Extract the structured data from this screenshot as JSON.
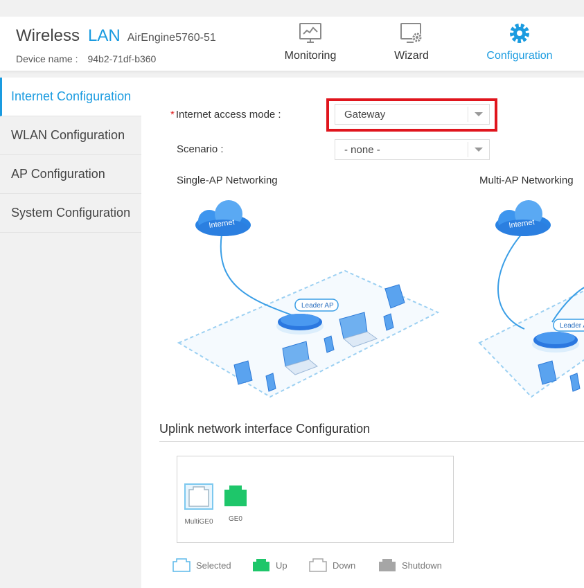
{
  "header": {
    "brand_wireless": "Wireless",
    "brand_lan": "LAN",
    "model": "AirEngine5760-51",
    "device_name_label": "Device name :",
    "device_name_value": "94b2-71df-b360",
    "nav": [
      {
        "label": "Monitoring",
        "icon": "monitor-chart-icon"
      },
      {
        "label": "Wizard",
        "icon": "monitor-gear-icon"
      },
      {
        "label": "Configuration",
        "icon": "gear-icon"
      }
    ],
    "active_nav": "Configuration"
  },
  "sidebar": {
    "items": [
      {
        "label": "Internet Configuration",
        "active": true
      },
      {
        "label": "WLAN Configuration"
      },
      {
        "label": "AP Configuration"
      },
      {
        "label": "System Configuration"
      }
    ]
  },
  "form": {
    "access_mode_label": "Internet access mode :",
    "access_mode_value": "Gateway",
    "scenario_label": "Scenario :",
    "scenario_value": "- none -"
  },
  "networking": {
    "single_title": "Single-AP Networking",
    "multi_title": "Multi-AP Networking",
    "internet_label": "Internet",
    "leader_ap_label": "Leader AP",
    "leader_ap_partial_label": "Leader A"
  },
  "uplink": {
    "title": "Uplink network interface Configuration",
    "ports": [
      {
        "label": "MultiGE0",
        "state": "selected"
      },
      {
        "label": "GE0",
        "state": "up"
      }
    ],
    "legend": [
      {
        "label": "Selected",
        "icon": "selected-port-icon"
      },
      {
        "label": "Up",
        "icon": "up-port-icon"
      },
      {
        "label": "Down",
        "icon": "down-port-icon"
      },
      {
        "label": "Shutdown",
        "icon": "shutdown-port-icon"
      }
    ]
  },
  "colors": {
    "accent": "#1a9be0",
    "highlight": "#e0151d",
    "port_up": "#1ec66a",
    "port_shutdown": "#a6a6a6"
  }
}
